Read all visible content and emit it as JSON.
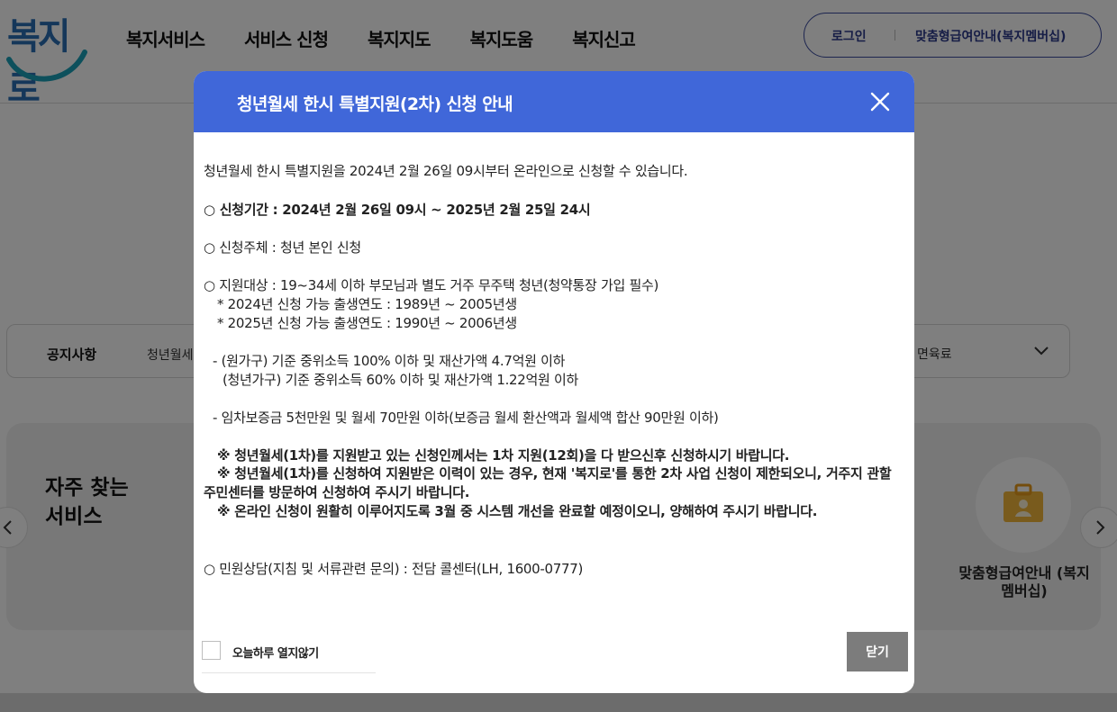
{
  "header": {
    "logo_text": "복지로",
    "nav": [
      "복지서비스",
      "서비스 신청",
      "복지지도",
      "복지도움",
      "복지신고"
    ],
    "login_label": "로그인",
    "membership_label": "맞춤형급여안내(복지멤버십)"
  },
  "notice": {
    "label": "공지사항",
    "text": "청년월세",
    "end_text": "면육료"
  },
  "frequent": {
    "title": "자주 찾는 서비스",
    "service_label": "맞춤형급여안내 (복지멤버십)"
  },
  "modal": {
    "title": "청년월세 한시 특별지원(2차) 신청 안내",
    "lines": {
      "intro": "청년월세 한시 특별지원을 2024년 2월 26일 09시부터 온라인으로 신청할 수 있습니다.",
      "period": "○ 신청기간 : 2024년 2월 26일 09시 ~ 2025년 2월 25일 24시",
      "subject": "○ 신청주체 : 청년 본인 신청",
      "target": "○ 지원대상 : 19~34세 이하 부모님과 별도 거주 무주택 청년(청약통장 가입 필수)",
      "birth_2024": "* 2024년 신청 가능 출생연도 : 1989년 ~ 2005년생",
      "birth_2025": "* 2025년 신청 가능 출생연도 : 1990년 ~ 2006년생",
      "income_origin": "- (원가구) 기준 중위소득 100% 이하 및 재산가액 4.7억원 이하",
      "income_youth": "(청년가구) 기준 중위소득 60% 이하 및 재산가액 1.22억원 이하",
      "deposit": "- 임차보증금 5천만원 및 월세 70만원 이하(보증금 월세 환산액과 월세액 합산 90만원 이하)",
      "note1": "※ 청년월세(1차)를 지원받고 있는 신청인께서는 1차 지원(12회)을 다 받으신후 신청하시기 바랍니다.",
      "note2": "※ 청년월세(1차)를 신청하여 지원받은 이력이 있는 경우, 현재 '복지로'를 통한 2차 사업 신청이 제한되오니, 거주지 관할 주민센터를 방문하여 신청하여 주시기 바랍니다.",
      "note3": "※ 온라인 신청이 원활히 이루어지도록 3월 중 시스템 개선을 완료할 예정이오니, 양해하여 주시기 바랍니다.",
      "contact": "○ 민원상담(지침 및 서류관련 문의) : 전담 콜센터(LH, 1600-0777)"
    },
    "dont_show_label": "오늘하루 열지않기",
    "close_label": "닫기"
  },
  "colors": {
    "modal_header": "#4067d9",
    "close_button": "#7c7c7c",
    "brand_blue": "#2a6fb5",
    "membership_border": "#3a4a9f"
  }
}
